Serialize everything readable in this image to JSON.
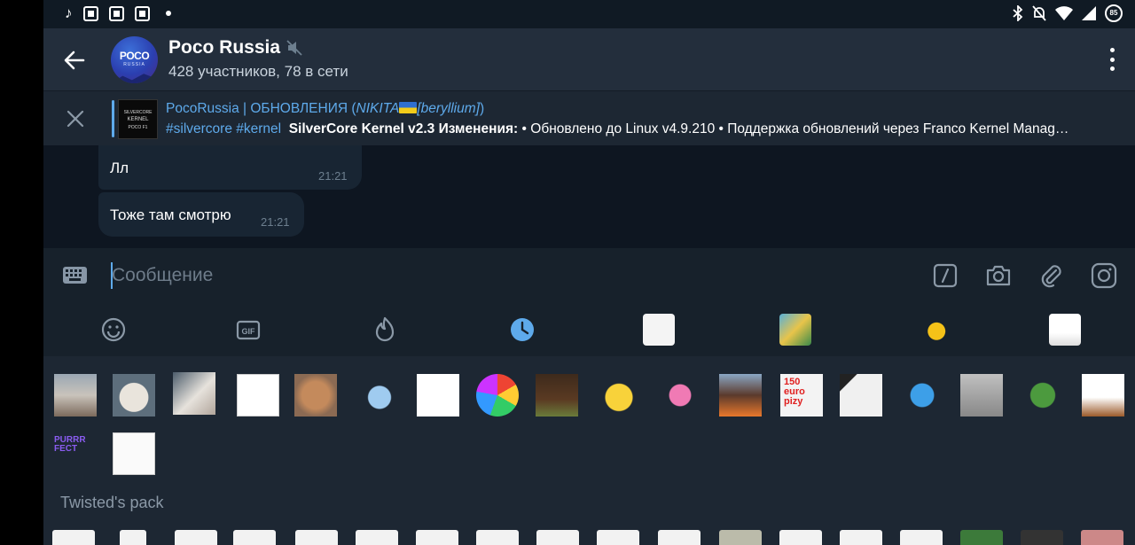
{
  "status_bar": {
    "battery": "85"
  },
  "header": {
    "title": "Poco Russia",
    "subtitle": "428 участников, 78 в сети",
    "avatar_text": "POCO",
    "avatar_subtext": "RUSSIA"
  },
  "pinned": {
    "source_prefix": "PocoRussia | ОБНОВЛЕНИЯ (",
    "source_name": "NIKITA",
    "source_tag": "[beryllium]",
    "source_suffix": ")",
    "hashtags": "#silvercore #kernel",
    "bold_text": "SilverCore Kernel v2.3 Изменения:",
    "body": "• Обновлено до Linux v4.9.210 • Поддержка обновлений через Franco Kernel Manag…",
    "thumb_line1": "SILVERCORE",
    "thumb_line2": "KERNEL",
    "thumb_line3": "POCO F1"
  },
  "messages": [
    {
      "text": "Лл",
      "time": "21:21"
    },
    {
      "text": "Тоже там смотрю",
      "time": "21:21"
    }
  ],
  "input": {
    "placeholder": "Сообщение"
  },
  "stickers": {
    "pack_title": "Twisted's pack",
    "sticker_texts": {
      "euro": "150 euro pizy",
      "purrr": "PURRR FECT"
    }
  },
  "colors": {
    "accent": "#5eaaeb",
    "header_bg": "#232e3c",
    "chat_bg": "#0e1621",
    "bubble_bg": "#182533",
    "panel_bg": "#17212b",
    "sticker_bg": "#1d2733"
  }
}
